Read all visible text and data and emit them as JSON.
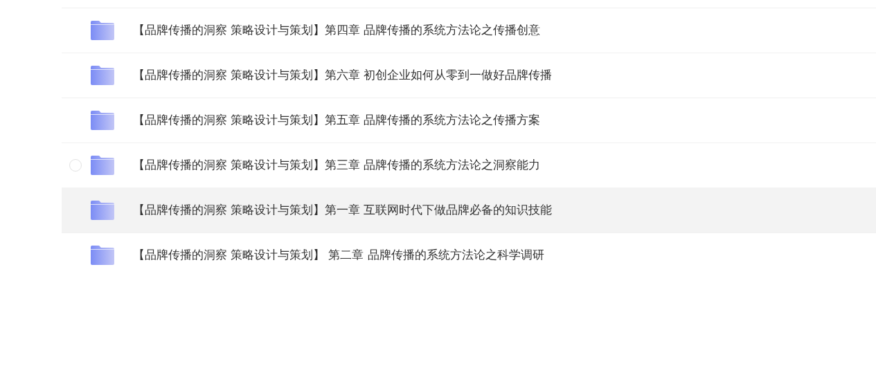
{
  "files": [
    {
      "name": "【品牌传播的洞察 策略设计与策划】第四章 品牌传播的系统方法论之传播创意",
      "selected": false,
      "hovered": false,
      "checked": false
    },
    {
      "name": "【品牌传播的洞察 策略设计与策划】第六章 初创企业如何从零到一做好品牌传播",
      "selected": false,
      "hovered": false,
      "checked": false
    },
    {
      "name": "【品牌传播的洞察 策略设计与策划】第五章 品牌传播的系统方法论之传播方案",
      "selected": false,
      "hovered": false,
      "checked": false
    },
    {
      "name": "【品牌传播的洞察 策略设计与策划】第三章 品牌传播的系统方法论之洞察能力",
      "selected": false,
      "hovered": true,
      "checked": false
    },
    {
      "name": "【品牌传播的洞察 策略设计与策划】第一章 互联网时代下做品牌必备的知识技能",
      "selected": true,
      "hovered": false,
      "checked": false
    },
    {
      "name": "【品牌传播的洞察 策略设计与策划】 第二章 品牌传播的系统方法论之科学调研",
      "selected": false,
      "hovered": false,
      "checked": false
    }
  ]
}
